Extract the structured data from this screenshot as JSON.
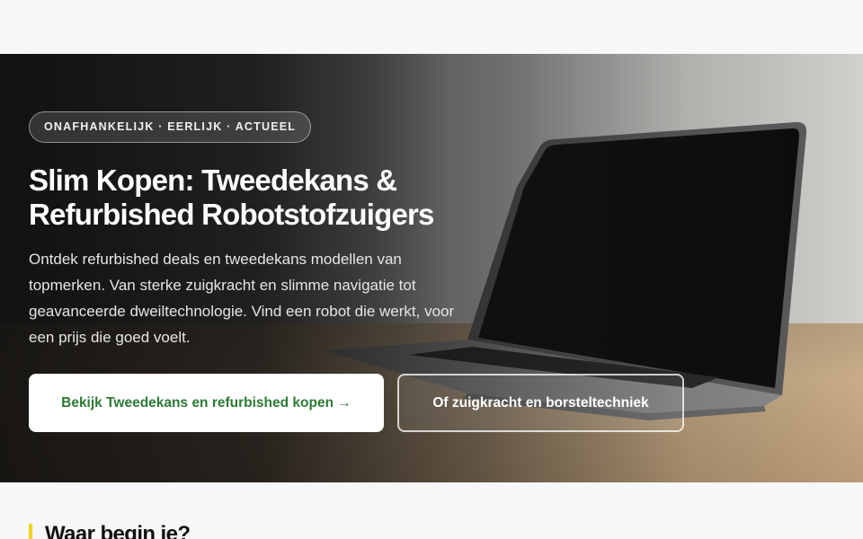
{
  "hero": {
    "badge": "ONAFHANKELIJK · EERLIJK · ACTUEEL",
    "title_line1": "Slim Kopen: Tweedekans &",
    "title_line2": "Refurbished Robotstofzuigers",
    "description": "Ontdek refurbished deals en tweedekans modellen van topmerken. Van sterke zuigkracht en slimme navigatie tot geavanceerde dweiltechnologie. Vind een robot die werkt, voor een prijs die goed voelt.",
    "primary_button": "Bekijk Tweedekans en refurbished kopen →",
    "secondary_button": "Of zuigkracht en borsteltechniek",
    "background_image": "laptop-on-desk"
  },
  "section": {
    "title": "Waar begin je?"
  },
  "colors": {
    "primary_text": "#2d7a34",
    "accent_bar": "#f2d21c",
    "page_background": "#f5f7f8"
  }
}
